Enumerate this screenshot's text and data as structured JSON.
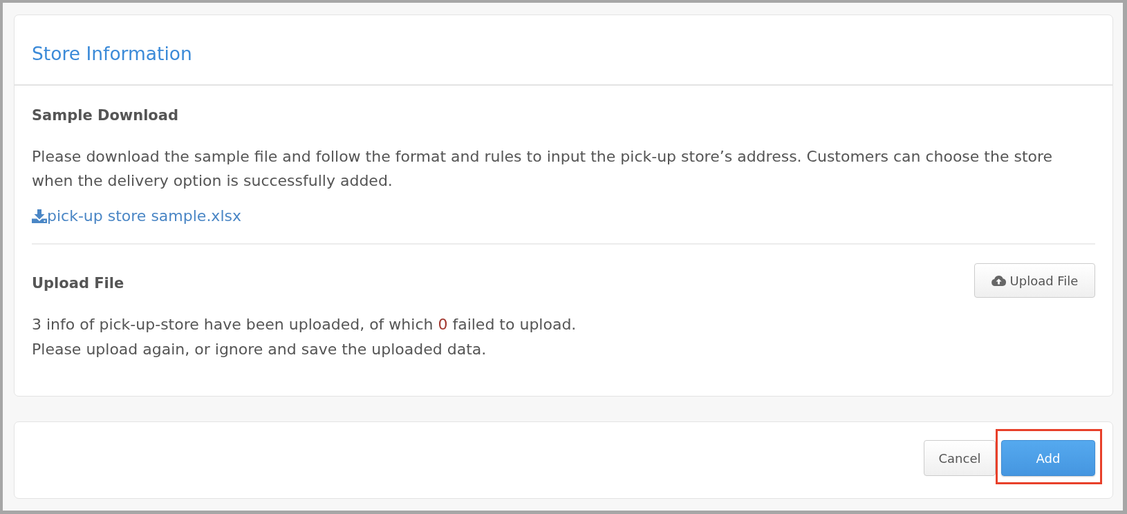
{
  "card": {
    "title": "Store Information"
  },
  "sample_download": {
    "heading": "Sample Download",
    "description": "Please download the sample file and follow the format and rules to input the pick-up store’s address. Customers can choose the store when the delivery option is successfully added.",
    "link": "pick-up store sample.xlsx"
  },
  "upload": {
    "heading": "Upload File",
    "button": "Upload File",
    "result": {
      "before": "3 info of pick-up-store have been uploaded, of which",
      "failed_count": "0",
      "after": "failed to upload."
    },
    "hint": "Please upload again, or ignore and save the uploaded data."
  },
  "footer": {
    "buttons": [
      {
        "kind": "secondary",
        "label": "Cancel",
        "highlighted": false
      },
      {
        "kind": "primary",
        "label": "Add",
        "highlighted": true
      }
    ]
  }
}
